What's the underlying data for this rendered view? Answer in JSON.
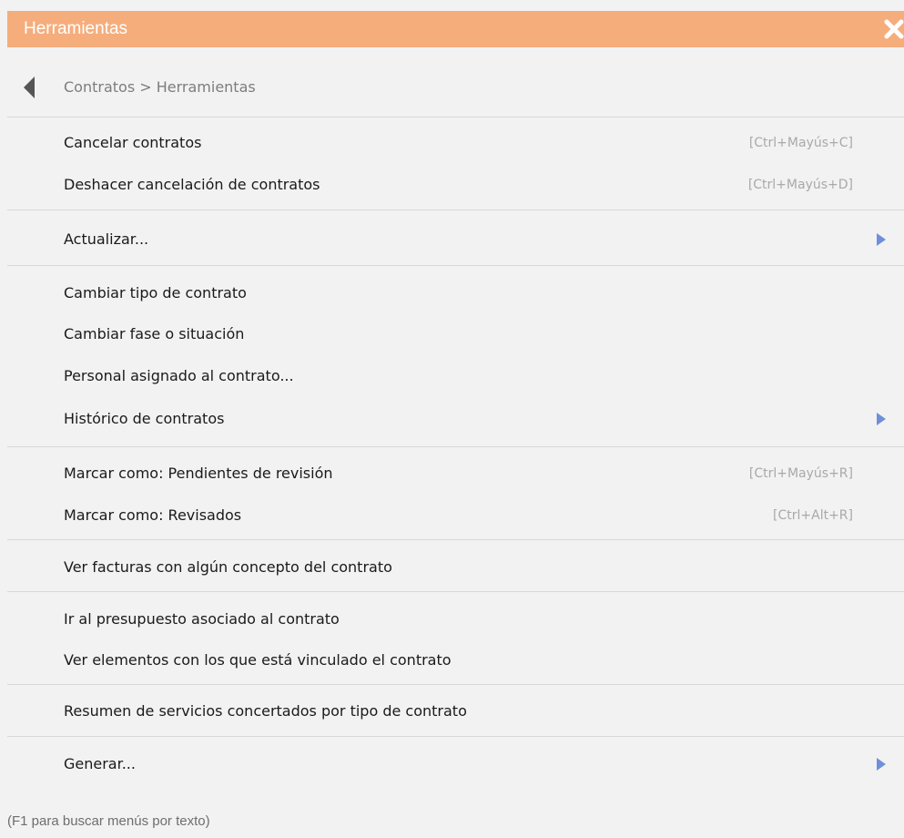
{
  "window": {
    "title": "Herramientas",
    "close_icon": "close-icon"
  },
  "breadcrumb": {
    "back_icon": "back-arrow-icon",
    "text": "Contratos > Herramientas"
  },
  "menu": {
    "items": [
      {
        "label": "Cancelar contratos",
        "shortcut": "[Ctrl+Mayús+C]"
      },
      {
        "label": "Deshacer cancelación de contratos",
        "shortcut": "[Ctrl+Mayús+D]"
      },
      {
        "label": "Actualizar...",
        "icon": "submenu-arrow-icon"
      },
      {
        "label": "Cambiar tipo de contrato"
      },
      {
        "label": "Cambiar fase o situación"
      },
      {
        "label": "Personal asignado al contrato..."
      },
      {
        "label": "Histórico de contratos",
        "icon": "submenu-arrow-icon"
      },
      {
        "label": "Marcar como: Pendientes de revisión",
        "shortcut": "[Ctrl+Mayús+R]"
      },
      {
        "label": "Marcar como: Revisados",
        "shortcut": "[Ctrl+Alt+R]"
      },
      {
        "label": "Ver facturas con algún concepto del contrato"
      },
      {
        "label": "Ir al presupuesto asociado al contrato"
      },
      {
        "label": "Ver elementos con los que está vinculado el contrato"
      },
      {
        "label": "Resumen de servicios concertados por tipo de contrato"
      },
      {
        "label": "Generar...",
        "icon": "submenu-arrow-icon"
      }
    ]
  },
  "footer": {
    "hint": "(F1 para buscar menús por texto)"
  },
  "colors": {
    "titlebar": "#f5ad7c",
    "submenu_arrow": "#6f8fd8",
    "divider": "#d8d8d8"
  }
}
